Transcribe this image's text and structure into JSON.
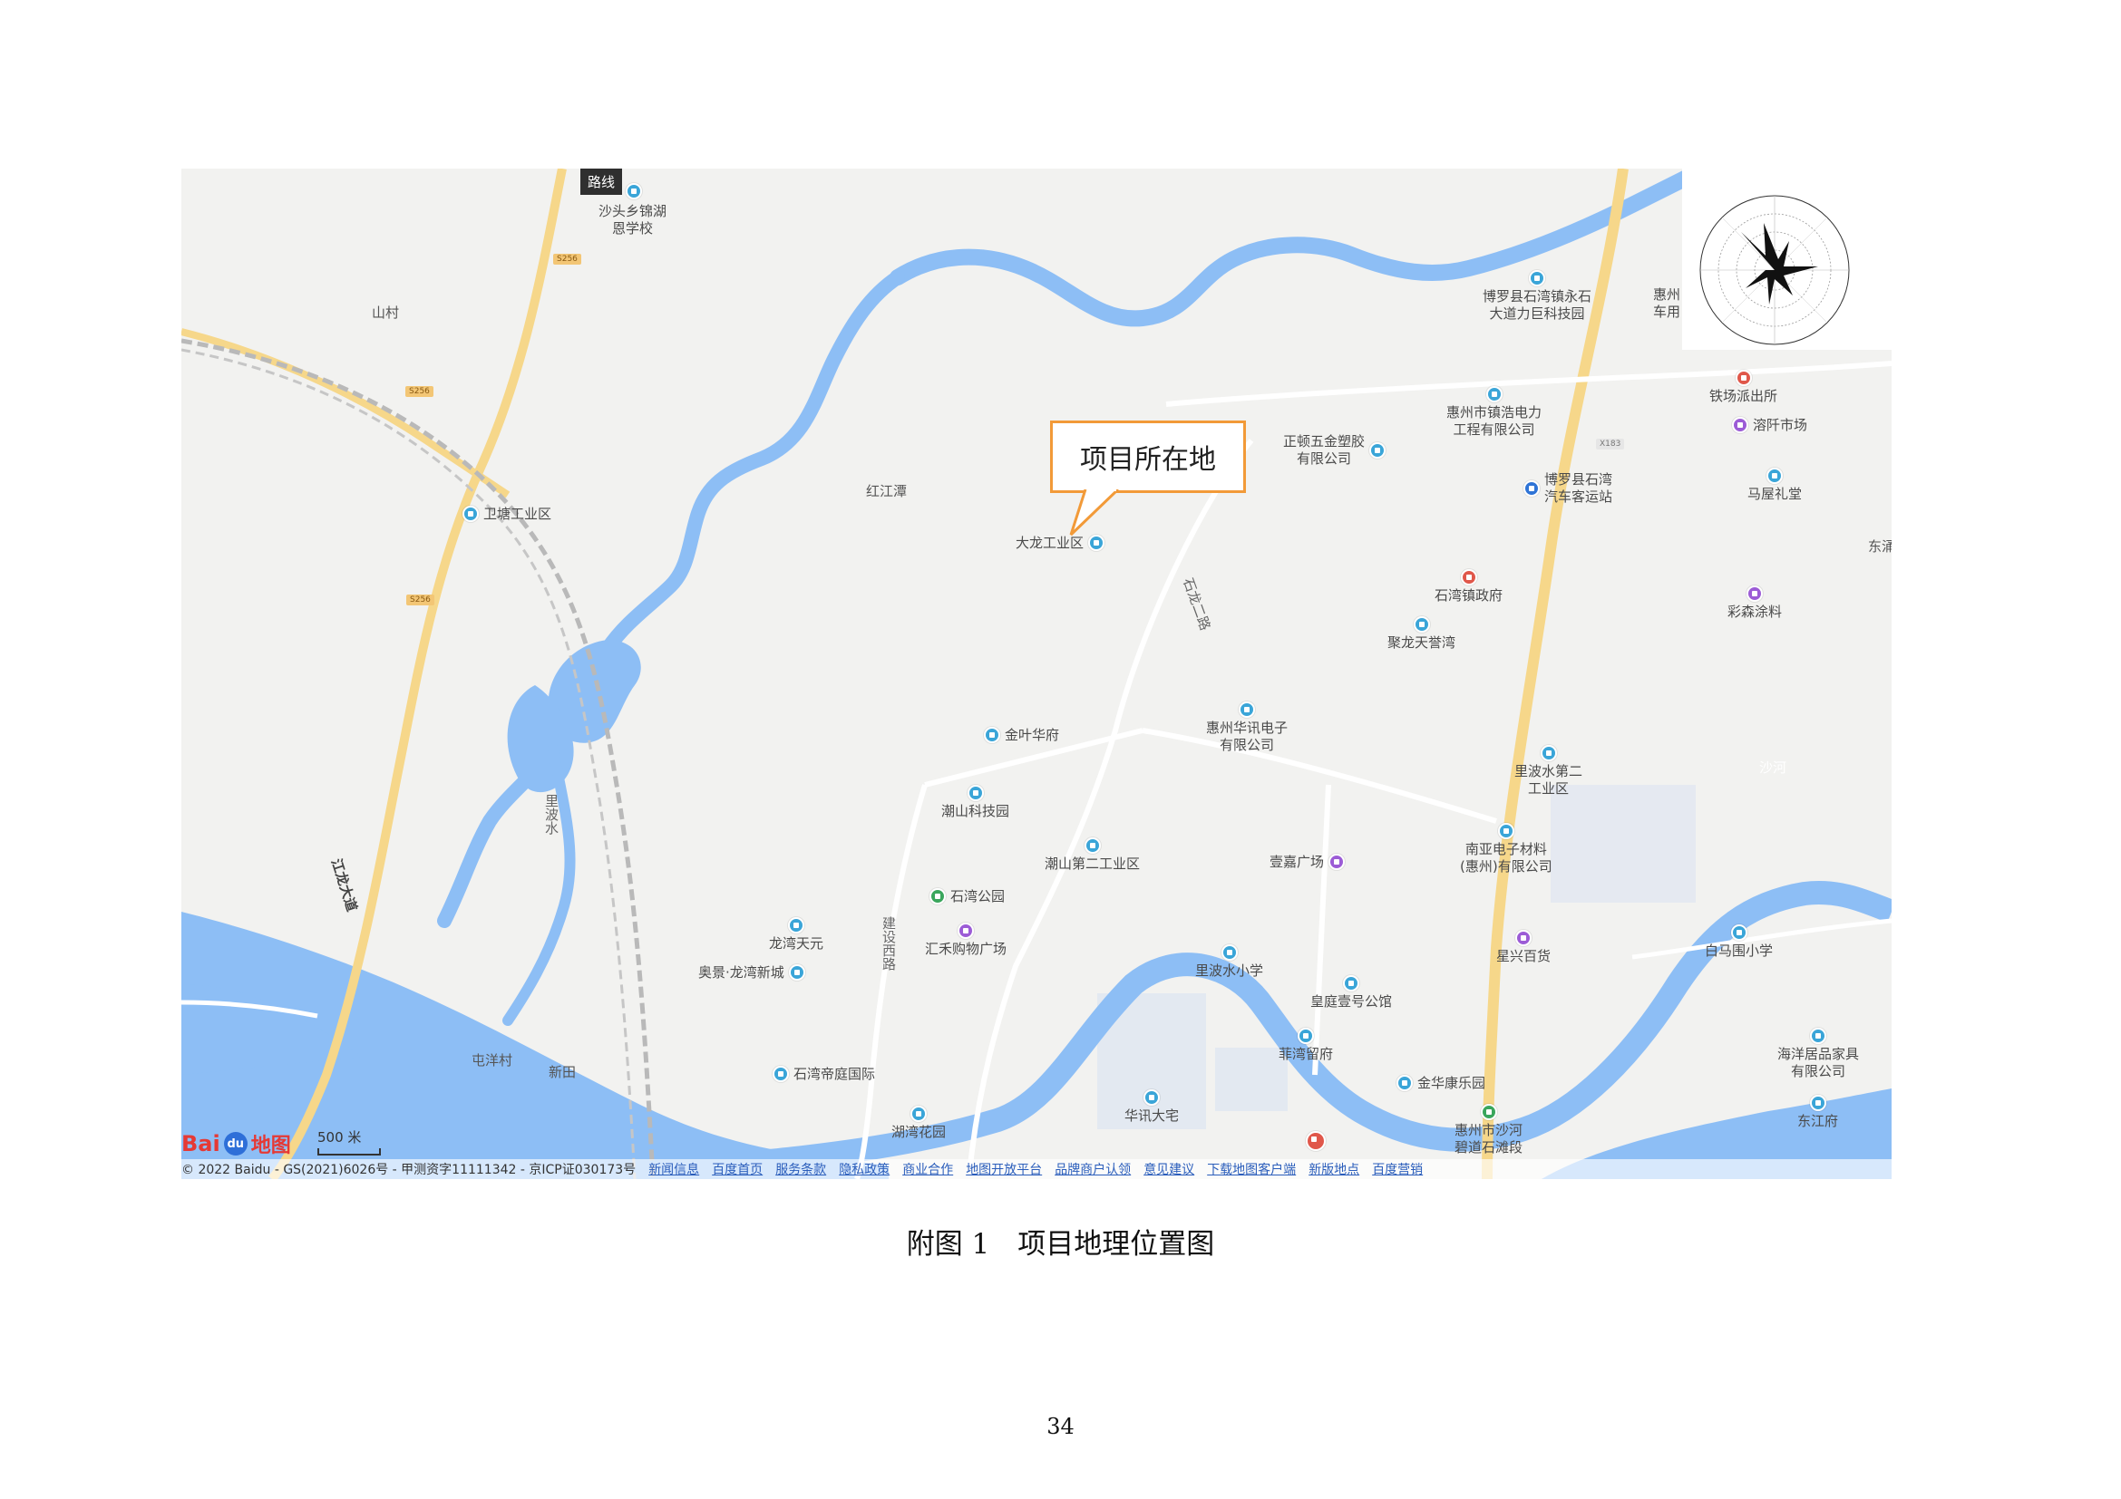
{
  "map": {
    "bus_tag": "路线",
    "callout_text": "项目所在地",
    "colors": {
      "water": "#8dbef5",
      "main_road": "#f6d78a",
      "land": "#f2f2f0",
      "industrial": "#dfe6f1"
    },
    "places": [
      "沙头乡锦湖\n恩学校",
      "山村",
      "卫塘工业区",
      "红江潭",
      "大龙工业区",
      "正顿五金塑胶\n有限公司",
      "博罗县石湾镇永石\n大道力巨科技园",
      "惠州\n车用",
      "惠州市镇浩电力\n工程有限公司",
      "铁场派出所",
      "溶阡市场",
      "博罗县石湾\n汽车客运站",
      "马屋礼堂",
      "东涌",
      "石湾镇政府",
      "彩森涂料",
      "聚龙天誉湾",
      "金叶华府",
      "惠州华讯电子\n有限公司",
      "里波水第二\n工业区",
      "潮山科技园",
      "潮山第二工业区",
      "壹嘉广场",
      "南亚电子材料\n(惠州)有限公司",
      "石湾公园",
      "汇禾购物广场",
      "龙湾天元",
      "奥景·龙湾新城",
      "里波水小学",
      "星兴百货",
      "白马围小学",
      "皇庭壹号公馆",
      "石湾帝庭国际",
      "菲湾留府",
      "金华康乐园",
      "海洋居品家具\n有限公司",
      "湖湾花园",
      "华讯大宅",
      "惠州市沙河\n碧道石滩段",
      "东江府",
      "新田",
      "屯洋村"
    ],
    "roads": [
      "江龙大道",
      "建设西路",
      "里波水",
      "沙河",
      "石龙二路"
    ],
    "shields": [
      "S256",
      "X183",
      "S256",
      "S256"
    ],
    "scale_label": "500 米",
    "logo": {
      "bai": "Bai",
      "du": "du",
      "ditu": "地图"
    },
    "copyright": "© 2022 Baidu - GS(2021)6026号 - 甲测资字11111342 - 京ICP证030173号",
    "footer_links": [
      "新闻信息",
      "百度首页",
      "服务条款",
      "隐私政策",
      "商业合作",
      "地图开放平台",
      "品牌商户认领",
      "意见建议",
      "下载地图客户端",
      "新版地点",
      "百度营销"
    ]
  },
  "caption": "附图 1　项目地理位置图",
  "page_number": "34"
}
